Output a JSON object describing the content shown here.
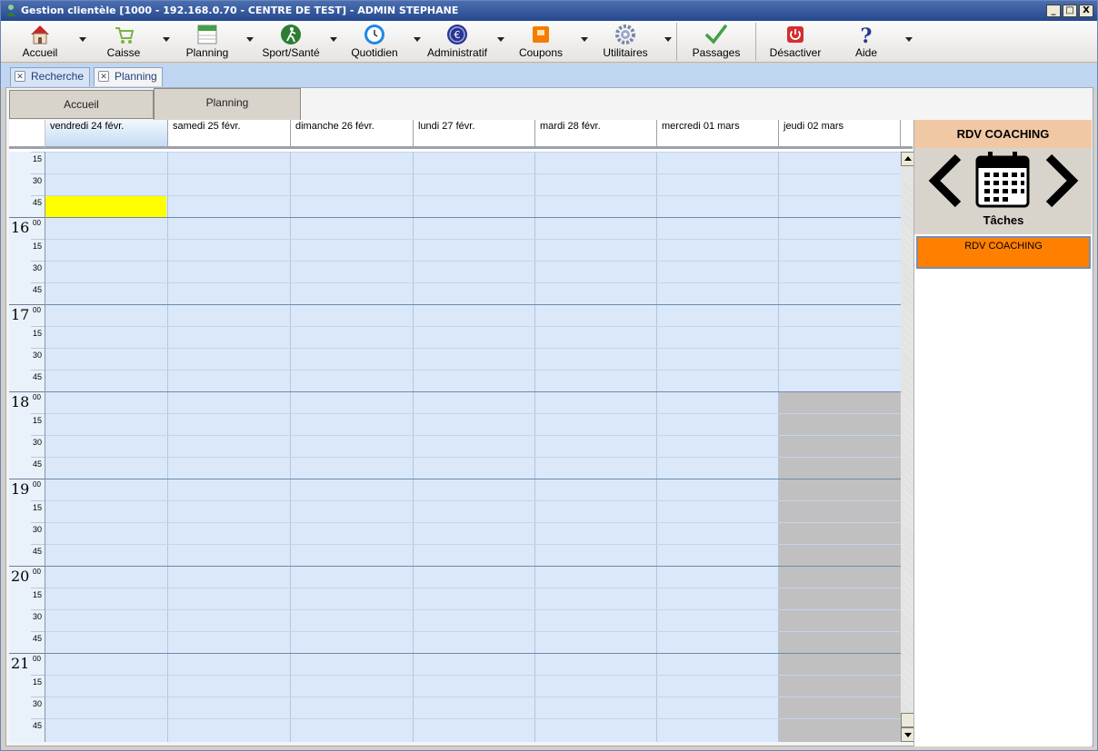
{
  "window": {
    "title": "Gestion clientèle [1000 - 192.168.0.70 - CENTRE DE TEST] - ADMIN STEPHANE",
    "minimize": "_",
    "maximize": "□",
    "close": "X"
  },
  "toolbar": {
    "items": [
      {
        "label": "Accueil",
        "icon": "house-icon"
      },
      {
        "label": "Caisse",
        "icon": "cart-icon"
      },
      {
        "label": "Planning",
        "icon": "calendar-icon"
      },
      {
        "label": "Sport/Santé",
        "icon": "runner-icon"
      },
      {
        "label": "Quotidien",
        "icon": "clock-icon"
      },
      {
        "label": "Administratif",
        "icon": "euro-icon"
      },
      {
        "label": "Coupons",
        "icon": "coupon-icon"
      },
      {
        "label": "Utilitaires",
        "icon": "gear-icon"
      },
      {
        "label": "Passages",
        "icon": "check-icon"
      },
      {
        "label": "Désactiver",
        "icon": "power-icon"
      },
      {
        "label": "Aide",
        "icon": "question-icon"
      }
    ]
  },
  "open_tabs": [
    {
      "label": "Recherche"
    },
    {
      "label": "Planning"
    }
  ],
  "inner_tabs": [
    {
      "label": "Accueil"
    },
    {
      "label": "Planning"
    }
  ],
  "calendar": {
    "days": [
      "vendredi 24 févr.",
      "samedi 25 févr.",
      "dimanche 26 févr.",
      "lundi 27 févr.",
      "mardi 28 févr.",
      "mercredi 01 mars",
      "jeudi 02 mars"
    ],
    "hours": [
      "16",
      "17",
      "18",
      "19",
      "20",
      "21"
    ],
    "hour_suffix": "00",
    "minutes": [
      "15",
      "30",
      "45"
    ],
    "highlight": {
      "day_index": 0,
      "time": "15:45"
    },
    "unavailable": {
      "day_index": 6,
      "from": "18:00"
    }
  },
  "panel": {
    "title": "RDV COACHING",
    "nav_label": "Tâches",
    "tasks": [
      {
        "label": "RDV COACHING",
        "color": "#ff8000"
      }
    ]
  }
}
